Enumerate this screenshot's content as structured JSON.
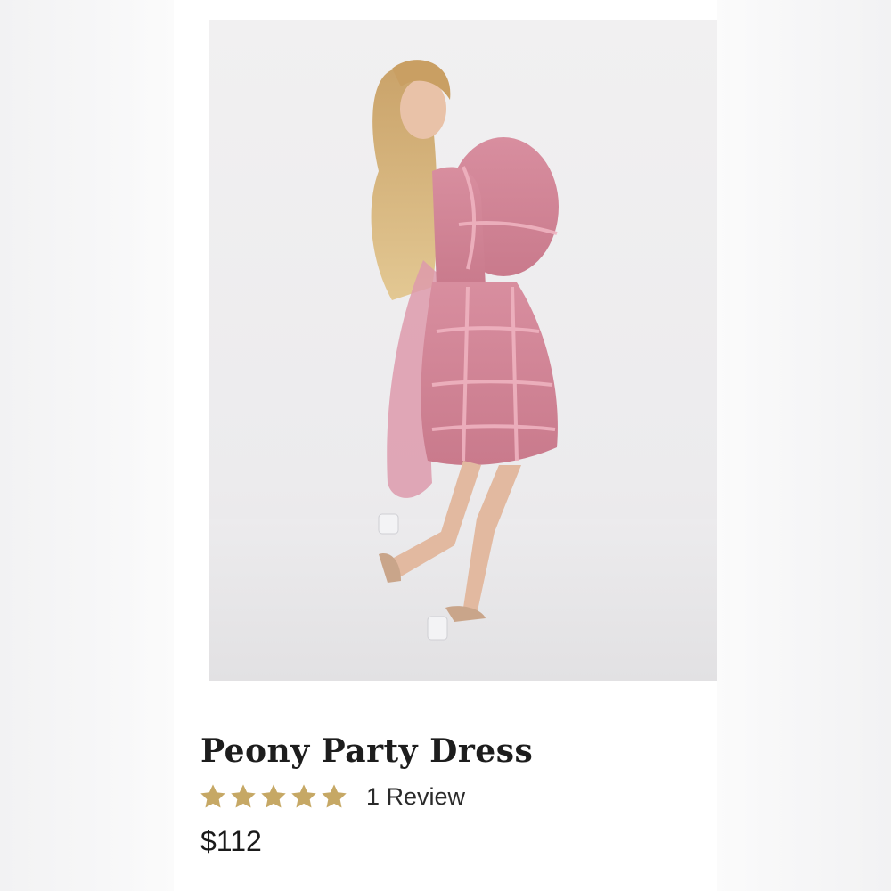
{
  "product": {
    "title": "Peony Party Dress",
    "rating": {
      "stars_filled": 5,
      "stars_total": 5,
      "star_color": "#C6A865",
      "review_label": "1 Review"
    },
    "price": "$112",
    "image": {
      "icon": "product-photo",
      "dress_color": "#D98E9E"
    }
  }
}
